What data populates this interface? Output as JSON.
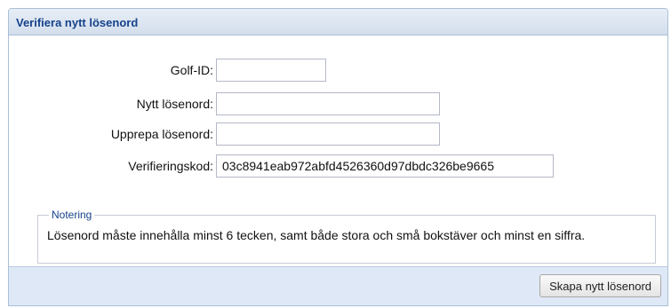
{
  "panel": {
    "title": "Verifiera nytt lösenord"
  },
  "form": {
    "golf_id": {
      "label": "Golf-ID:",
      "value": ""
    },
    "new_password": {
      "label": "Nytt lösenord:",
      "value": ""
    },
    "repeat_password": {
      "label": "Upprepa lösenord:",
      "value": ""
    },
    "verification_code": {
      "label": "Verifieringskod:",
      "value": "03c8941eab972abfd4526360d97dbdc326be9665"
    }
  },
  "note": {
    "legend": "Notering",
    "text": "Lösenord måste innehålla minst 6 tecken, samt både stora och små bokstäver och minst en siffra."
  },
  "footer": {
    "submit_label": "Skapa nytt lösenord"
  },
  "colors": {
    "title": "#15428b",
    "header_bg": "#dce6f3",
    "footer_bg": "#dfe8f6",
    "border": "#a9bfd6"
  }
}
